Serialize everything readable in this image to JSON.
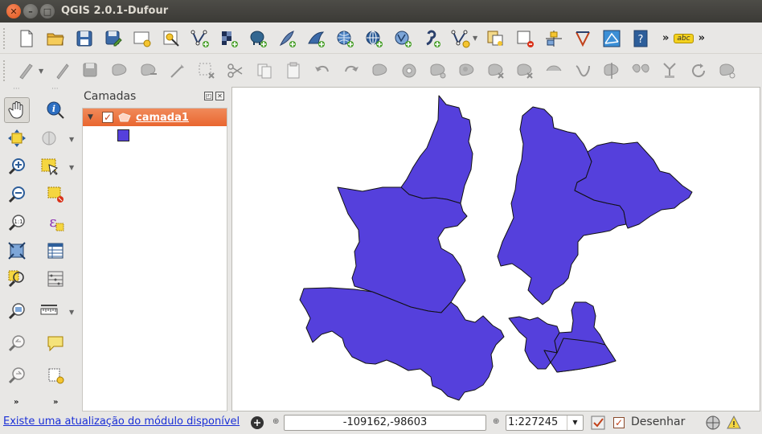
{
  "window": {
    "title": "QGIS 2.0.1-Dufour"
  },
  "toolbar_primary": {
    "more": "»",
    "label_tool": "abc"
  },
  "toolbar_secondary": {},
  "left_tools": {
    "more_left": "»",
    "more_right": "»"
  },
  "layers_panel": {
    "title": "Camadas",
    "layers": [
      {
        "name": "camada1",
        "checked": true,
        "color": "#5540dc"
      }
    ]
  },
  "map": {
    "fill_color": "#5540dc",
    "stroke_color": "#111111"
  },
  "statusbar": {
    "message": "Existe uma atualização do módulo disponível",
    "coord_label": "⊕",
    "coordinates": "-109162,-98603",
    "scale": "1:227245",
    "render_checked": true,
    "render_label": "Desenhar"
  }
}
